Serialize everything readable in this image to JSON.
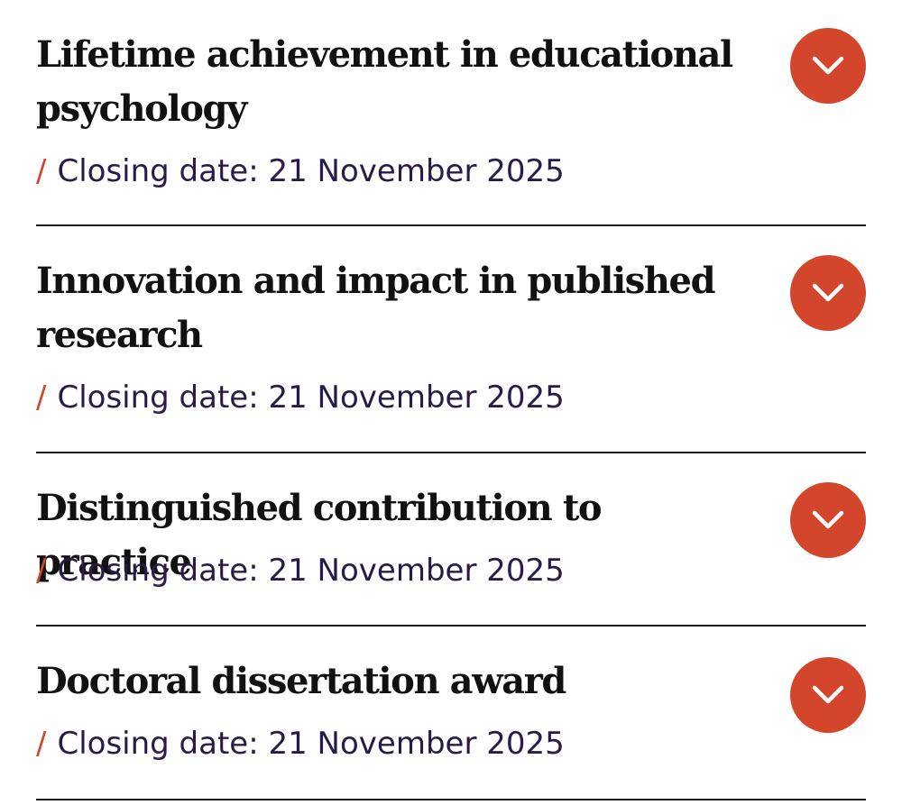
{
  "awards": [
    {
      "title": "Lifetime achievement in educational psychology",
      "closing_separator": "/",
      "closing_text": "Closing date: 21 November 2025",
      "toggle_icon": "chevron-down-icon"
    },
    {
      "title": "Innovation and impact in published research",
      "closing_separator": "/",
      "closing_text": "Closing date: 21 November 2025",
      "toggle_icon": "chevron-down-icon"
    },
    {
      "title": "Distinguished contribution to practice",
      "closing_separator": "/",
      "closing_text": "Closing date: 21 November 2025",
      "toggle_icon": "chevron-down-icon"
    },
    {
      "title": "Doctoral dissertation award",
      "closing_separator": "/",
      "closing_text": "Closing date: 21 November 2025",
      "toggle_icon": "chevron-down-icon"
    }
  ],
  "colors": {
    "accent": "#d4462c",
    "title_text": "#111111",
    "meta_text": "#2a1a4a",
    "divider": "#1a1a1a"
  }
}
